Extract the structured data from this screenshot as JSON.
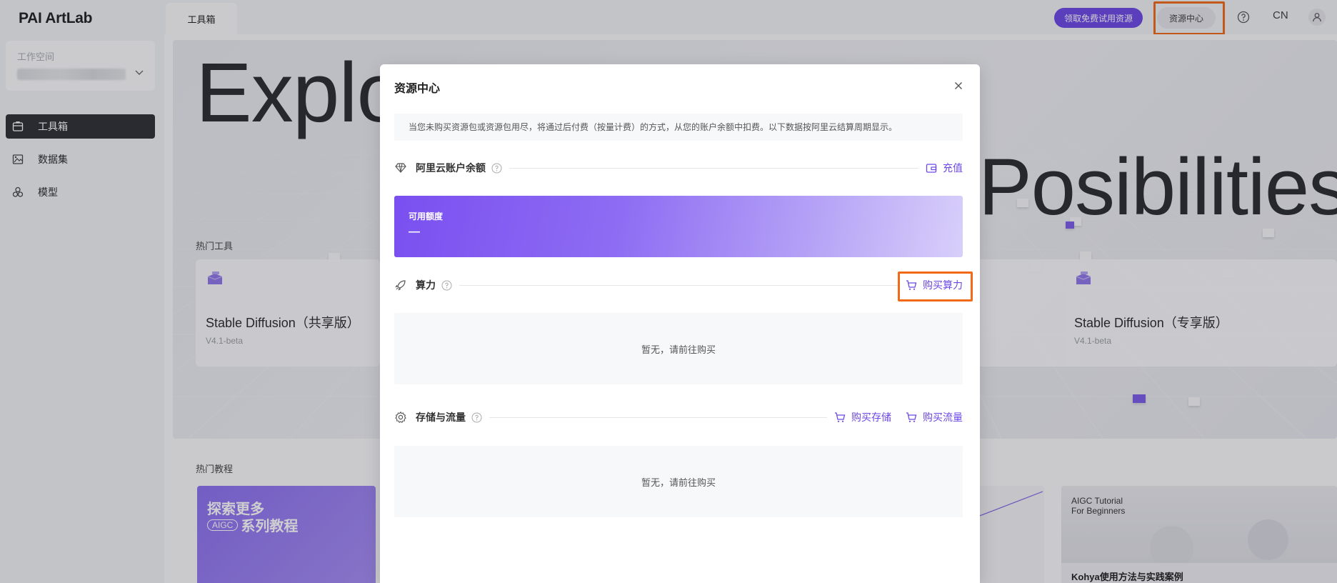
{
  "app": {
    "logo": "PAI ArtLab"
  },
  "sidebar": {
    "workspace_label": "工作空间",
    "items": [
      {
        "label": "工具箱",
        "icon": "toolbox-icon",
        "active": true
      },
      {
        "label": "数据集",
        "icon": "dataset-icon",
        "active": false
      },
      {
        "label": "模型",
        "icon": "model-icon",
        "active": false
      }
    ]
  },
  "header": {
    "tab": "工具箱",
    "promo_label": "领取免费试用资源",
    "resource_center_label": "资源中心",
    "help_icon": "help-icon",
    "lang": "CN",
    "user_icon": "user-icon"
  },
  "hero": {
    "title_left": "Explo",
    "title_right": "Posibilities"
  },
  "hot_tools": {
    "label": "热门工具",
    "cards": [
      {
        "name": "Stable Diffusion（共享版）",
        "version": "V4.1-beta"
      },
      {
        "name": "Stable Diffusion（专享版）",
        "version": "V4.1-beta"
      }
    ]
  },
  "hot_tutorials": {
    "label": "热门教程",
    "card1": {
      "line1": "探索更多",
      "badge": "AIGC",
      "line2": "系列教程"
    },
    "card2": {
      "caption1": "AIGC Tutorial",
      "caption2": "For Beginners",
      "title": "Kohya使用方法与实践案例"
    }
  },
  "modal": {
    "title": "资源中心",
    "notice": "当您未购买资源包或资源包用尽，将通过后付费（按量计费）的方式，从您的账户余额中扣费。以下数据按阿里云结算周期显示。",
    "balance_section": {
      "title": "阿里云账户余额",
      "link": "充值"
    },
    "balance_card": {
      "label": "可用额度",
      "value": "—"
    },
    "compute_section": {
      "title": "算力",
      "link": "购买算力",
      "empty": "暂无，请前往购买"
    },
    "storage_section": {
      "title": "存储与流量",
      "link1": "购买存储",
      "link2": "购买流量",
      "empty": "暂无，请前往购买"
    }
  },
  "colors": {
    "accent": "#6c47e6",
    "highlight": "#f06a17",
    "active_nav": "#2e2f33"
  }
}
